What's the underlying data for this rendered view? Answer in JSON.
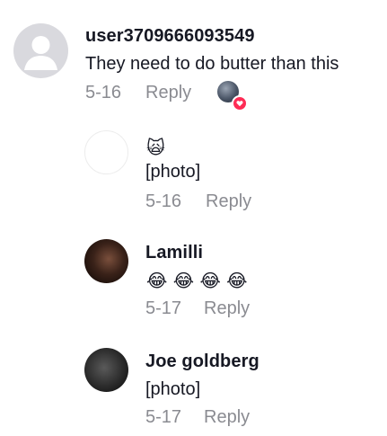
{
  "comments": [
    {
      "username": "user3709666093549",
      "text": "They need to do butter than this",
      "date": "5-16",
      "reply_label": "Reply",
      "avatar_icon": "default-avatar-icon"
    }
  ],
  "replies": [
    {
      "username": "",
      "emoji": "🙀",
      "text": "[photo]",
      "date": "5-16",
      "reply_label": "Reply"
    },
    {
      "username": "Lamilli",
      "emoji": "😂 😂 😂 😂",
      "date": "5-17",
      "reply_label": "Reply"
    },
    {
      "username": "Joe goldberg",
      "text": "[photo]",
      "date": "5-17",
      "reply_label": "Reply"
    }
  ],
  "colors": {
    "text": "#161823",
    "secondary": "#8a8b91",
    "like_badge": "#fe2c55"
  }
}
